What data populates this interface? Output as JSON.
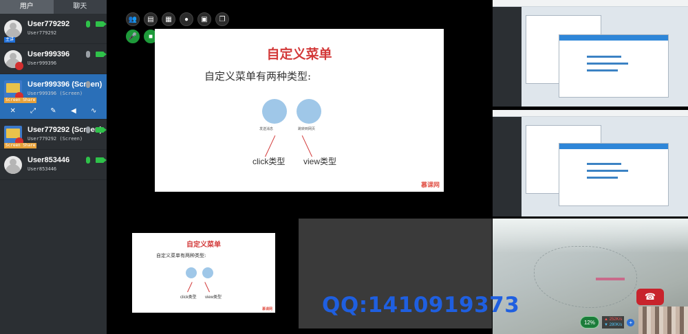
{
  "sidebar": {
    "tabs": [
      {
        "label": "用户",
        "active": true
      },
      {
        "label": "聊天",
        "active": false
      }
    ],
    "users": [
      {
        "name": "User779292",
        "sub": "User779292",
        "host_badge": "主讲",
        "mic": "on",
        "cam": "on"
      },
      {
        "name": "User999396",
        "sub": "User999396",
        "mic": "off",
        "cam": "on"
      },
      {
        "name": "User999396 (Screen)",
        "sub": "User999396 (Screen)",
        "tag": "Screen Share",
        "mic": "off",
        "selected": true
      },
      {
        "name": "User779292 (Screen)",
        "sub": "User779292 (Screen)",
        "tag": "Screen Share",
        "mic": "off",
        "cam": "on"
      },
      {
        "name": "User853446",
        "sub": "User853446",
        "mic": "on",
        "cam": "on"
      }
    ]
  },
  "slide": {
    "title": "自定义菜单",
    "text": "自定义菜单有两种类型:",
    "icon1_label": "发送消息",
    "icon2_label": "跳转到网页",
    "caption1": "click类型",
    "caption2": "view类型",
    "logo": "慕课网"
  },
  "watermark": "QQ:1410919373",
  "network": {
    "quality": "12%",
    "up": "252K/s",
    "down": "280K/s"
  },
  "colors": {
    "accent": "#2a6fb8",
    "green": "#2fc24a",
    "title_red": "#d33a3a",
    "watermark": "#1f5fe0"
  }
}
